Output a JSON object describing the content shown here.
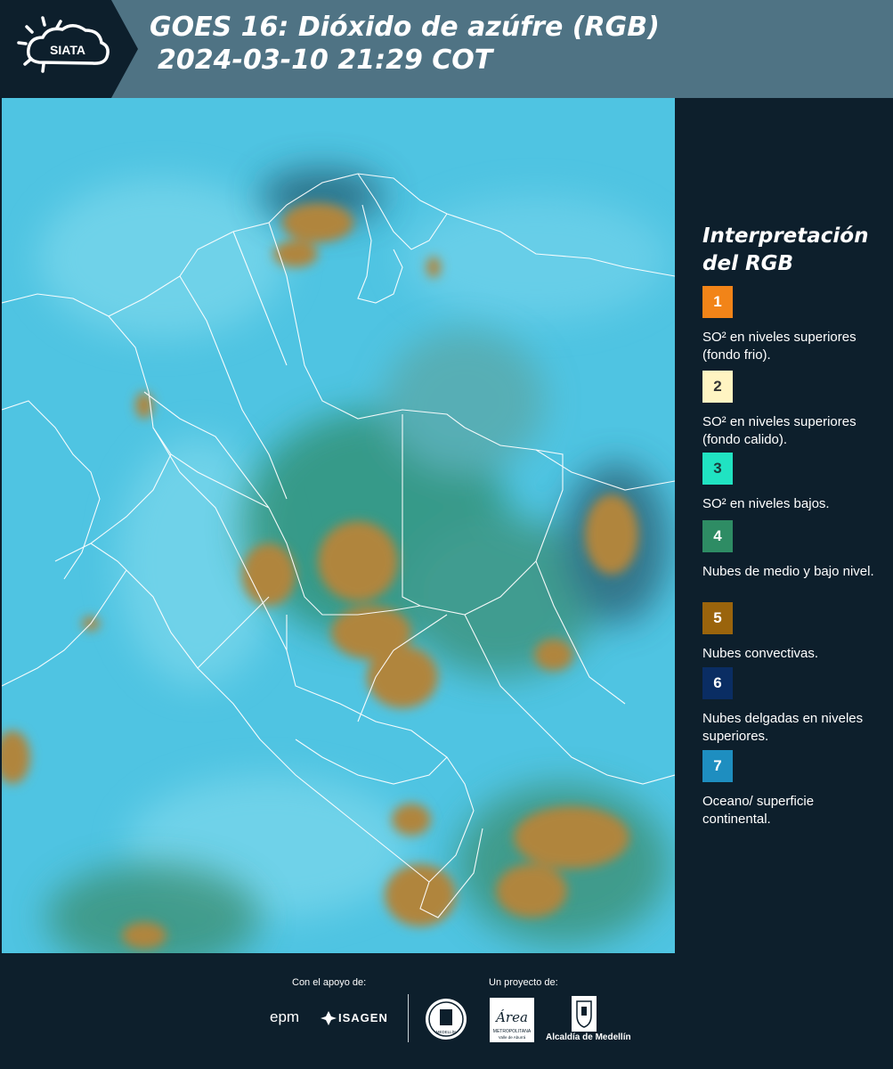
{
  "header": {
    "logo_text": "SIATA",
    "title_line1": "GOES 16: Dióxido de azúfre (RGB)",
    "title_line2": "2024-03-10 21:29 COT",
    "background": "#4f7384"
  },
  "legend": {
    "title_line1": "Interpretación",
    "title_line2": "del RGB",
    "items": [
      {
        "number": "1",
        "color": "#f28418",
        "text": "SO² en niveles superiores (fondo frio)."
      },
      {
        "number": "2",
        "color": "#fff4c2",
        "text": "SO² en niveles superiores (fondo calido)."
      },
      {
        "number": "3",
        "color": "#20e3c2",
        "text": "SO² en niveles bajos."
      },
      {
        "number": "4",
        "color": "#2e8c64",
        "text": "Nubes de medio y bajo nivel."
      },
      {
        "number": "5",
        "color": "#9a640c",
        "text": "Nubes convectivas."
      },
      {
        "number": "6",
        "color": "#0a2d63",
        "text": "Nubes delgadas en niveles superiores."
      },
      {
        "number": "7",
        "color": "#1e8ec0",
        "text": "Oceano/ superficie continental."
      }
    ]
  },
  "footer": {
    "support_label": "Con el apoyo de:",
    "project_label": "Un proyecto de:",
    "sponsor1": "epm",
    "sponsor2": "ISAGEN",
    "partner1": "MEDELLÍN",
    "partner2_name": "Área",
    "partner2_sub": "METROPOLITANA",
    "partner2_sub2": "Valle de Aburrá",
    "partner3": "Alcaldía de Medellín"
  }
}
